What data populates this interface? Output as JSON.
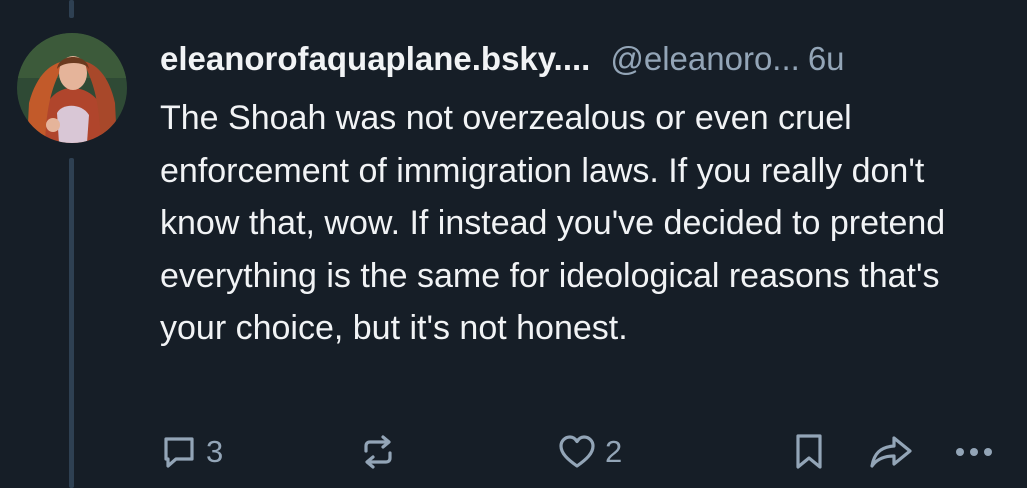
{
  "post": {
    "display_name": "eleanorofaquaplane.bsky....",
    "handle": "@eleanoro...",
    "time": "6u",
    "text": "The Shoah was not overzealous or even cruel enforcement of immigration laws. If you really don't know that, wow. If instead you've decided to pretend everything is the same for ideological reasons that's your choice, but it's not honest."
  },
  "actions": {
    "reply_count": "3",
    "like_count": "2"
  },
  "icons": {
    "reply": "speech-bubble-icon",
    "repost": "repost-arrows-icon",
    "like": "heart-icon",
    "bookmark": "bookmark-icon",
    "share": "share-arrow-icon",
    "more": "more-dots-icon"
  },
  "colors": {
    "background": "#161e27",
    "text": "#f1f3f5",
    "muted": "#93a5b7",
    "thread_line": "#2e4052"
  }
}
